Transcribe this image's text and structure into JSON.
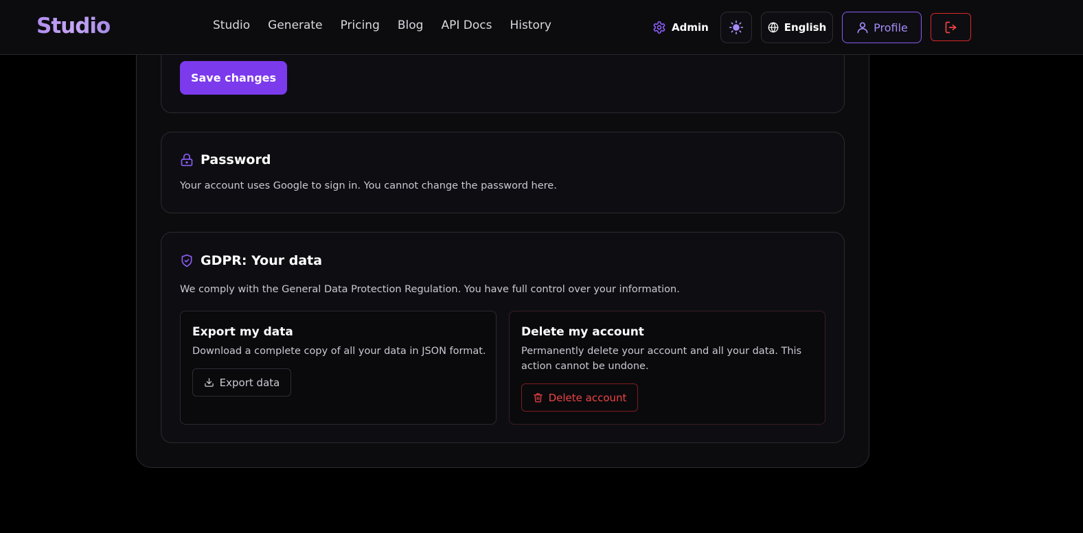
{
  "app": {
    "logo": "Studio"
  },
  "nav": {
    "links": [
      "Studio",
      "Generate",
      "Pricing",
      "Blog",
      "API Docs",
      "History"
    ],
    "admin_label": "Admin",
    "language_label": "English",
    "profile_label": "Profile"
  },
  "profile_section": {
    "save_label": "Save changes"
  },
  "password_section": {
    "title": "Password",
    "description": "Your account uses Google to sign in. You cannot change the password here."
  },
  "gdpr_section": {
    "title": "GDPR: Your data",
    "description": "We comply with the General Data Protection Regulation. You have full control over your information.",
    "export": {
      "title": "Export my data",
      "description": "Download a complete copy of all your data in JSON format.",
      "button_label": "Export data"
    },
    "delete": {
      "title": "Delete my account",
      "description_line1": "Permanently delete your account and all your data. This",
      "description_line2": "action cannot be undone.",
      "button_label": "Delete account"
    }
  },
  "icons": {
    "admin": "gear-icon",
    "theme": "sun-icon",
    "language": "globe-icon",
    "profile": "user-icon",
    "logout": "logout-icon",
    "password": "lock-icon",
    "gdpr": "shield-check-icon",
    "export": "download-icon",
    "delete": "trash-icon"
  },
  "colors": {
    "accent": "#7c3aed",
    "accent_light": "#a78bfa",
    "danger": "#ef4444",
    "background": "#000000",
    "card": "#0e0e12"
  }
}
